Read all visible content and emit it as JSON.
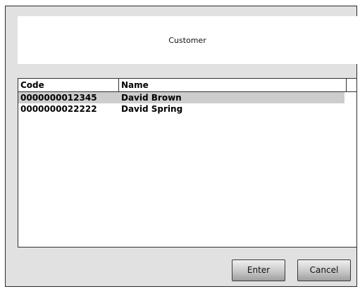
{
  "dialog": {
    "title": "Customer"
  },
  "list": {
    "columns": [
      {
        "label": "Code"
      },
      {
        "label": "Name"
      }
    ],
    "rows": [
      {
        "code": "0000000012345",
        "name": "David Brown",
        "selected": true
      },
      {
        "code": "0000000022222",
        "name": "David Spring",
        "selected": false
      }
    ]
  },
  "buttons": {
    "enter_label": "Enter",
    "cancel_label": "Cancel"
  },
  "colors": {
    "dialog_background": "#e1e1e1",
    "selected_row": "#cdcdcd"
  }
}
